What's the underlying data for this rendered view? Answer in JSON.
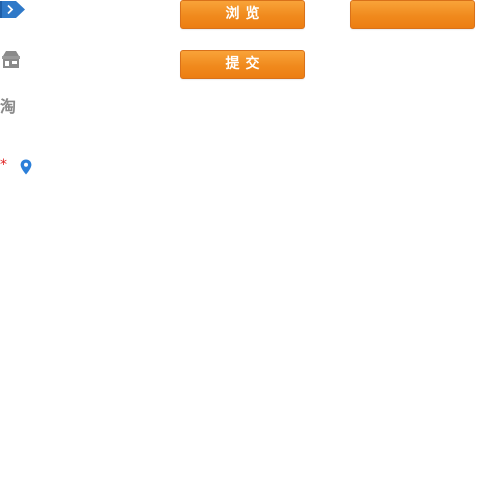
{
  "icons": {
    "tag": "arrow-tag-icon",
    "shop": "shop-icon",
    "taobao": "淘",
    "location": "location-pin-icon"
  },
  "required_mark": "*",
  "buttons": {
    "browse_label": "浏览",
    "submit_label": "提交",
    "blank_label": ""
  },
  "colors": {
    "button_orange": "#f08a1d",
    "tag_blue": "#2f79c8",
    "pin_blue": "#2b7fd9",
    "required_red": "#e02020",
    "icon_gray": "#8a8a8a"
  }
}
